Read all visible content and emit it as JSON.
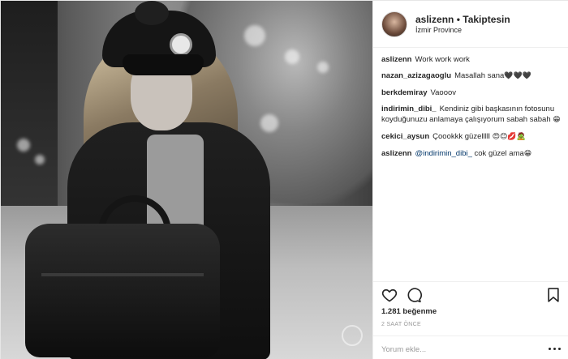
{
  "post": {
    "author": "aslizenn",
    "follow_label": "Takiptesin",
    "location": "İzmir Province"
  },
  "comments": [
    {
      "author": "aslizenn",
      "text": "Work work work"
    },
    {
      "author": "nazan_azizagaoglu",
      "text": "Masallah sana",
      "emoji": "🖤🖤🖤"
    },
    {
      "author": "berkdemiray",
      "text": "Vaooov"
    },
    {
      "author": "indirimin_dibi_",
      "text": "Kendiniz gibi başkasının fotosunu koyduğunuzu anlamaya çalışıyorum sabah sabah",
      "emoji": "😁"
    },
    {
      "author": "cekici_aysun",
      "text": "Çoookkk güzelllll",
      "emoji": "😍😊💋🧟"
    },
    {
      "author": "aslizenn",
      "mention": "@indirimin_dibi_",
      "text": "cok güzel ama",
      "emoji": "😁"
    }
  ],
  "likes": "1.281 beğenme",
  "time": "2 SAAT ÖNCE",
  "add_comment_placeholder": "Yorum ekle...",
  "icons": {
    "like": "heart-icon",
    "comment": "comment-icon",
    "save": "bookmark-icon",
    "more": "more-options-icon"
  }
}
